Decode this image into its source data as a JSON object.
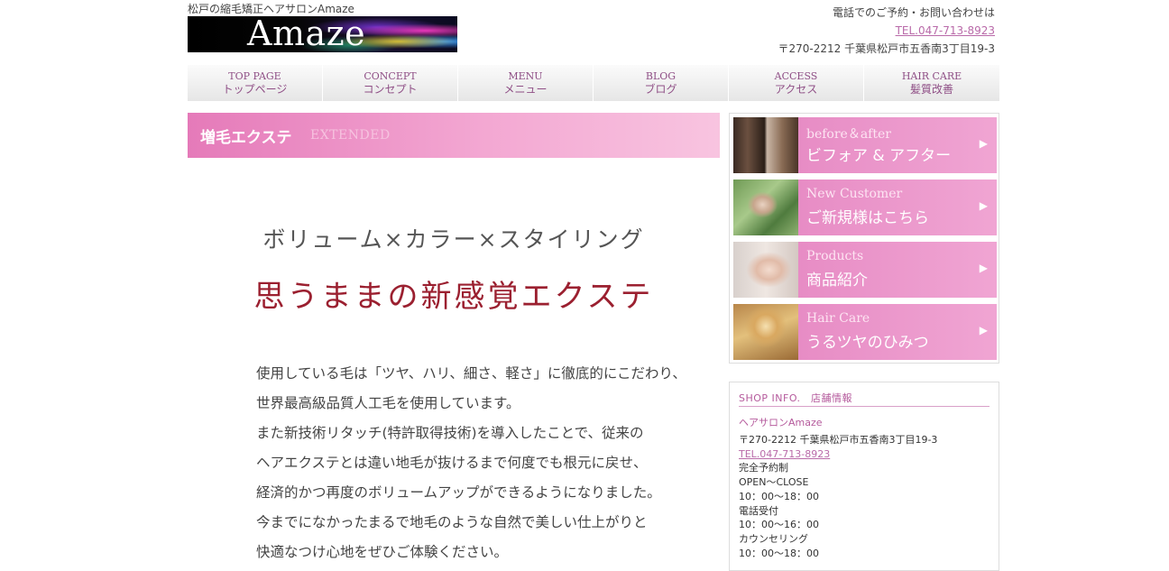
{
  "header": {
    "tagline": "松戸の縮毛矯正ヘアサロンAmaze",
    "logo_text": "Amaze",
    "contact_label": "電話でのご予約・お問い合わせは",
    "tel": "TEL.047-713-8923",
    "address": "〒270-2212 千葉県松戸市五香南3丁目19-3"
  },
  "nav": {
    "items": [
      {
        "en": "TOP PAGE",
        "jp": "トップページ"
      },
      {
        "en": "CONCEPT",
        "jp": "コンセプト"
      },
      {
        "en": "MENU",
        "jp": "メニュー"
      },
      {
        "en": "BLOG",
        "jp": "ブログ"
      },
      {
        "en": "ACCESS",
        "jp": "アクセス"
      },
      {
        "en": "HAIR CARE",
        "jp": "髪質改善"
      }
    ]
  },
  "main": {
    "heading_jp": "増毛エクステ",
    "heading_en": "EXTENDED",
    "subheading": "ボリューム×カラー×スタイリング",
    "catch": "思うままの新感覚エクステ",
    "lines": [
      "使用している毛は「ツヤ、ハリ、細さ、軽さ」に徹底的にこだわり、",
      "世界最高級品質人工毛を使用しています。",
      "また新技術リタッチ(特許取得技術)を導入したことで、従来の",
      "ヘアエクステとは違い地毛が抜けるまで何度でも根元に戻せ、",
      "経済的かつ再度のボリュームアップができるようになりました。",
      "今までになかったまるで地毛のような自然で美しい仕上がりと",
      "快適なつけ心地をぜひご体験ください。"
    ]
  },
  "sidebar": {
    "banners": [
      {
        "en": "before＆after",
        "jp": "ビフォア & アフター"
      },
      {
        "en": "New Customer",
        "jp": "ご新規様はこちら"
      },
      {
        "en": "Products",
        "jp": "商品紹介"
      },
      {
        "en": "Hair Care",
        "jp": "うるツヤのひみつ"
      }
    ],
    "shop": {
      "title": "SHOP INFO.　店舗情報",
      "name": "ヘアサロンAmaze",
      "address": "〒270-2212 千葉県松戸市五香南3丁目19-3",
      "tel": "TEL.047-713-8923",
      "lines": [
        "完全予約制",
        "OPEN～CLOSE",
        "10：00～18：00",
        "電話受付",
        "10：00～16：00",
        "カウンセリング",
        "10：00～18：00"
      ]
    }
  }
}
